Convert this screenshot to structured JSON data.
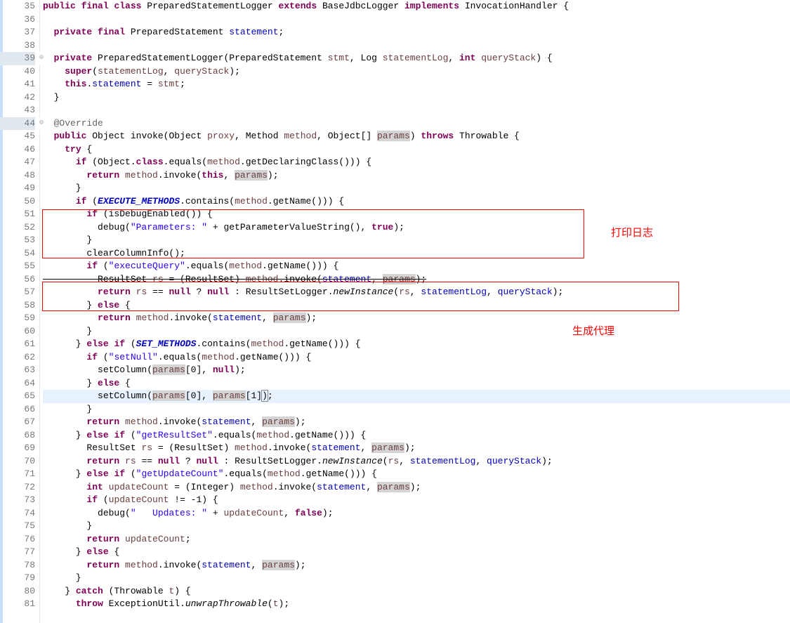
{
  "lineNumbers": [
    "35",
    "36",
    "37",
    "38",
    "39",
    "40",
    "41",
    "42",
    "43",
    "44",
    "45",
    "46",
    "47",
    "48",
    "49",
    "50",
    "51",
    "52",
    "53",
    "54",
    "55",
    "56",
    "57",
    "58",
    "59",
    "60",
    "61",
    "62",
    "63",
    "64",
    "65",
    "66",
    "67",
    "68",
    "69",
    "70",
    "71",
    "72",
    "73",
    "74",
    "75",
    "76",
    "77",
    "78",
    "79",
    "80",
    "81"
  ],
  "annotations": {
    "a1": "打印日志",
    "a2": "生成代理"
  },
  "code": {
    "l35_kw1": "public",
    "l35_kw2": "final",
    "l35_kw3": "class",
    "l35_cls": "PreparedStatementLogger",
    "l35_kw4": "extends",
    "l35_base": "BaseJdbcLogger",
    "l35_kw5": "implements",
    "l35_iface": "InvocationHandler {",
    "l37_kw1": "private",
    "l37_kw2": "final",
    "l37_type": "PreparedStatement",
    "l37_field": "statement",
    "l37_semi": ";",
    "l39_kw1": "private",
    "l39_ctor": "PreparedStatementLogger(PreparedStatement",
    "l39_p1": "stmt",
    "l39_c2": ", Log",
    "l39_p2": "statementLog",
    "l39_c3": ",",
    "l39_kw2": "int",
    "l39_p3": "queryStack",
    "l39_end": ") {",
    "l40_kw": "super",
    "l40_args": "(",
    "l40_a1": "statementLog",
    "l40_c": ", ",
    "l40_a2": "queryStack",
    "l40_end": ");",
    "l41_kw": "this",
    "l41_dot": ".",
    "l41_f": "statement",
    "l41_eq": " = ",
    "l41_v": "stmt",
    "l41_semi": ";",
    "l42": "  }",
    "l44": "@Override",
    "l45_kw1": "public",
    "l45_ret": "Object",
    "l45_name": "invoke(Object",
    "l45_p1": "proxy",
    "l45_c1": ", Method",
    "l45_p2": "method",
    "l45_c2": ", Object[]",
    "l45_p3": "params",
    "l45_end": ")",
    "l45_kw2": "throws",
    "l45_thr": "Throwable {",
    "l46_kw": "try",
    "l46_b": " {",
    "l47_kw": "if",
    "l47_cond": " (Object.",
    "l47_cls": "class",
    "l47_mid": ".equals(",
    "l47_m": "method",
    "l47_call": ".getDeclaringClass())) {",
    "l48_kw": "return",
    "l48_m": "method",
    "l48_inv": ".invoke(",
    "l48_kw2": "this",
    "l48_c": ", ",
    "l48_p": "params",
    "l48_end": ");",
    "l49": "      }",
    "l50_kw": "if",
    "l50_o": " (",
    "l50_const": "EXECUTE_METHODS",
    "l50_rest": ".contains(",
    "l50_m": "method",
    "l50_call": ".getName())) {",
    "l51_kw": "if",
    "l51_cond": " (isDebugEnabled()) {",
    "l52_call": "debug(",
    "l52_str": "\"Parameters: \"",
    "l52_plus": " + getParameterValueString(), ",
    "l52_kw": "true",
    "l52_end": ");",
    "l53": "        }",
    "l54": "        clearColumnInfo();",
    "l55_kw": "if",
    "l55_o": " (",
    "l55_str": "\"executeQuery\"",
    "l55_rest": ".equals(",
    "l55_m": "method",
    "l55_call": ".getName())) {",
    "l56_pre": "          ",
    "l56_t": "ResultSet ",
    "l56_v": "rs",
    "l56_eq": " = (ResultSet) ",
    "l56_m": "method",
    "l56_inv": ".invoke(",
    "l56_f": "statement",
    "l56_c": ", ",
    "l56_p": "params",
    "l56_end": ");",
    "l57_kw": "return",
    "l57_v": "rs",
    "l57_eq": " == ",
    "l57_kw2": "null",
    "l57_q": " ? ",
    "l57_kw3": "null",
    "l57_col": " : ResultSetLogger.",
    "l57_ni": "newInstance",
    "l57_o": "(",
    "l57_v2": "rs",
    "l57_c": ", ",
    "l57_f": "statementLog",
    "l57_c2": ", ",
    "l57_f2": "queryStack",
    "l57_end": ");",
    "l58_cb": "        } ",
    "l58_kw": "else",
    "l58_ob": " {",
    "l59_kw": "return",
    "l59_m": "method",
    "l59_inv": ".invoke(",
    "l59_f": "statement",
    "l59_c": ", ",
    "l59_p": "params",
    "l59_end": ");",
    "l60": "        }",
    "l61_cb": "      } ",
    "l61_kw": "else",
    "l61_sp": " ",
    "l61_kw2": "if",
    "l61_o": " (",
    "l61_const": "SET_METHODS",
    "l61_rest": ".contains(",
    "l61_m": "method",
    "l61_call": ".getName())) {",
    "l62_kw": "if",
    "l62_o": " (",
    "l62_str": "\"setNull\"",
    "l62_rest": ".equals(",
    "l62_m": "method",
    "l62_call": ".getName())) {",
    "l63_call": "setColumn(",
    "l63_p": "params",
    "l63_idx": "[0], ",
    "l63_kw": "null",
    "l63_end": ");",
    "l64_cb": "        } ",
    "l64_kw": "else",
    "l64_ob": " {",
    "l65_call": "setColumn(",
    "l65_p1": "params",
    "l65_i1": "[0], ",
    "l65_p2": "params",
    "l65_i2": "[1]",
    "l65_cur": ")",
    "l65_end": ";",
    "l66": "        }",
    "l67_kw": "return",
    "l67_m": "method",
    "l67_inv": ".invoke(",
    "l67_f": "statement",
    "l67_c": ", ",
    "l67_p": "params",
    "l67_end": ");",
    "l68_cb": "      } ",
    "l68_kw": "else",
    "l68_sp": " ",
    "l68_kw2": "if",
    "l68_o": " (",
    "l68_str": "\"getResultSet\"",
    "l68_rest": ".equals(",
    "l68_m": "method",
    "l68_call": ".getName())) {",
    "l69_pre": "        ResultSet ",
    "l69_v": "rs",
    "l69_eq": " = (ResultSet) ",
    "l69_m": "method",
    "l69_inv": ".invoke(",
    "l69_f": "statement",
    "l69_c": ", ",
    "l69_p": "params",
    "l69_end": ");",
    "l70_kw": "return",
    "l70_v": "rs",
    "l70_eq": " == ",
    "l70_kw2": "null",
    "l70_q": " ? ",
    "l70_kw3": "null",
    "l70_col": " : ResultSetLogger.",
    "l70_ni": "newInstance",
    "l70_o": "(",
    "l70_v2": "rs",
    "l70_c": ", ",
    "l70_f": "statementLog",
    "l70_c2": ", ",
    "l70_f2": "queryStack",
    "l70_end": ");",
    "l71_cb": "      } ",
    "l71_kw": "else",
    "l71_sp": " ",
    "l71_kw2": "if",
    "l71_o": " (",
    "l71_str": "\"getUpdateCount\"",
    "l71_rest": ".equals(",
    "l71_m": "method",
    "l71_call": ".getName())) {",
    "l72_kw": "int",
    "l72_v": "updateCount",
    "l72_eq": " = (Integer) ",
    "l72_m": "method",
    "l72_inv": ".invoke(",
    "l72_f": "statement",
    "l72_c": ", ",
    "l72_p": "params",
    "l72_end": ");",
    "l73_kw": "if",
    "l73_cond": " (",
    "l73_v": "updateCount",
    "l73_neq": " != -1) {",
    "l74_call": "debug(",
    "l74_str": "\"   Updates: \"",
    "l74_plus": " + ",
    "l74_v": "updateCount",
    "l74_c": ", ",
    "l74_kw": "false",
    "l74_end": ");",
    "l75": "        }",
    "l76_kw": "return",
    "l76_sp": " ",
    "l76_v": "updateCount",
    "l76_end": ";",
    "l77_cb": "      } ",
    "l77_kw": "else",
    "l77_ob": " {",
    "l78_kw": "return",
    "l78_m": "method",
    "l78_inv": ".invoke(",
    "l78_f": "statement",
    "l78_c": ", ",
    "l78_p": "params",
    "l78_end": ");",
    "l79": "      }",
    "l80_cb": "    } ",
    "l80_kw": "catch",
    "l80_o": " (Throwable ",
    "l80_v": "t",
    "l80_end": ") {",
    "l81_kw": "throw",
    "l81_rest": " ExceptionUtil.",
    "l81_m": "unwrapThrowable",
    "l81_o": "(",
    "l81_v": "t",
    "l81_end": ");"
  }
}
